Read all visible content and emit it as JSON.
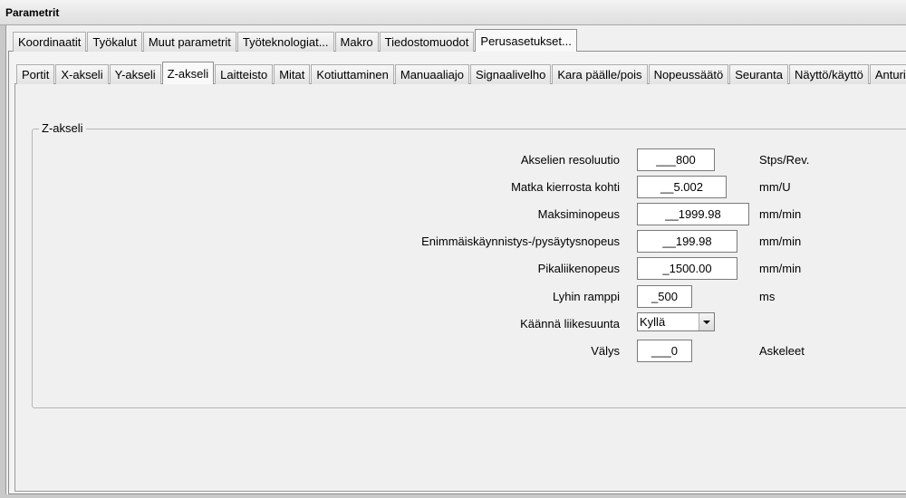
{
  "window": {
    "title": "Parametrit"
  },
  "top_tabs": [
    "Koordinaatit",
    "Työkalut",
    "Muut parametrit",
    "Työteknologiat...",
    "Makro",
    "Tiedostomuodot",
    "Perusasetukset..."
  ],
  "top_active": "Perusasetukset...",
  "sub_tabs": [
    "Portit",
    "X-akseli",
    "Y-akseli",
    "Z-akseli",
    "Laitteisto",
    "Mitat",
    "Kotiuttaminen",
    "Manuaaliajo",
    "Signaalivelho",
    "Kara päälle/pois",
    "Nopeussäätö",
    "Seuranta",
    "Näyttö/käyttö",
    "Anturi"
  ],
  "sub_active": "Z-akseli",
  "group": {
    "label": "Z-akseli",
    "resolution": {
      "label": "Akselien resoluutio",
      "value": "___800",
      "unit": "Stps/Rev."
    },
    "travel": {
      "label": "Matka kierrosta kohti",
      "value": "__5.002",
      "unit": "mm/U"
    },
    "max_speed": {
      "label": "Maksiminopeus",
      "value": "__1999.98",
      "unit": "mm/min"
    },
    "start_stop": {
      "label": "Enimmäiskäynnistys-/pysäytysnopeus",
      "value": "__199.98",
      "unit": "mm/min"
    },
    "rapid": {
      "label": "Pikaliikenopeus",
      "value": "_1500.00",
      "unit": "mm/min"
    },
    "short_ramp": {
      "label": "Lyhin ramppi",
      "value": "_500",
      "unit": "ms"
    },
    "reverse": {
      "label": "Käännä liikesuunta",
      "selected": "Kyllä"
    },
    "backlash": {
      "label": "Välys",
      "value": "___0",
      "unit": "Askeleet"
    }
  }
}
